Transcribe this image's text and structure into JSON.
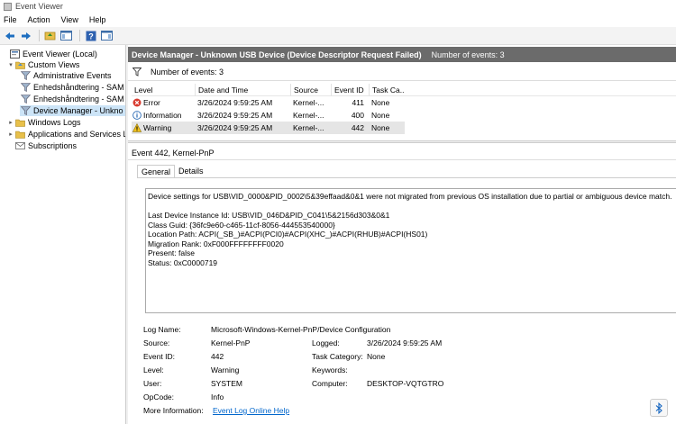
{
  "window": {
    "title": "Event Viewer"
  },
  "menu": [
    "File",
    "Action",
    "View",
    "Help"
  ],
  "toolbar": {
    "icons": [
      "back-arrow-icon",
      "forward-arrow-icon",
      "folder-up-icon",
      "console-tree-icon",
      "help-icon",
      "action-pane-icon"
    ]
  },
  "tree": {
    "root": "Event Viewer (Local)",
    "custom_views": "Custom Views",
    "admin_events": "Administrative Events",
    "enh1": "Enhedshåndtering - SAM",
    "enh2": "Enhedshåndtering - SAM",
    "device_manager": "Device Manager - Unkno",
    "windows_logs": "Windows Logs",
    "app_services": "Applications and Services Lo",
    "subscriptions": "Subscriptions"
  },
  "header": {
    "title": "Device Manager - Unknown USB Device (Device Descriptor Request Failed)",
    "count": "Number of events: 3"
  },
  "filter": {
    "label": "Number of events: 3"
  },
  "grid": {
    "columns": [
      "Level",
      "Date and Time",
      "Source",
      "Event ID",
      "Task Ca..."
    ],
    "rows": [
      {
        "level": "Error",
        "icon": "error-icon",
        "datetime": "3/26/2024 9:59:25 AM",
        "source": "Kernel-...",
        "event_id": "411",
        "task": "None"
      },
      {
        "level": "Information",
        "icon": "info-icon",
        "datetime": "3/26/2024 9:59:25 AM",
        "source": "Kernel-...",
        "event_id": "400",
        "task": "None"
      },
      {
        "level": "Warning",
        "icon": "warning-icon",
        "datetime": "3/26/2024 9:59:25 AM",
        "source": "Kernel-...",
        "event_id": "442",
        "task": "None"
      }
    ]
  },
  "details": {
    "title": "Event 442, Kernel-PnP",
    "tabs": [
      "General",
      "Details"
    ],
    "description": [
      "Device settings for USB\\VID_0000&PID_0002\\5&39effaad&0&1 were not migrated from previous OS installation due to partial or ambiguous device match.",
      "",
      "Last Device Instance Id: USB\\VID_046D&PID_C041\\5&2156d303&0&1",
      "Class Guid: {36fc9e60-c465-11cf-8056-444553540000}",
      "Location Path: ACPI(_SB_)#ACPI(PCI0)#ACPI(XHC_)#ACPI(RHUB)#ACPI(HS01)",
      "Migration Rank: 0xF000FFFFFFFF0020",
      "Present: false",
      "Status: 0xC0000719"
    ],
    "props": {
      "log_name_label": "Log Name:",
      "log_name": "Microsoft-Windows-Kernel-PnP/Device Configuration",
      "source_label": "Source:",
      "source": "Kernel-PnP",
      "logged_label": "Logged:",
      "logged": "3/26/2024 9:59:25 AM",
      "event_id_label": "Event ID:",
      "event_id": "442",
      "task_label": "Task Category:",
      "task": "None",
      "level_label": "Level:",
      "level": "Warning",
      "keywords_label": "Keywords:",
      "keywords": "",
      "user_label": "User:",
      "user": "SYSTEM",
      "computer_label": "Computer:",
      "computer": "DESKTOP-VQTGTRO",
      "opcode_label": "OpCode:",
      "opcode": "Info",
      "more_info_label": "More Information:",
      "more_info_link": "Event Log Online Help"
    }
  },
  "colors": {
    "header_bg": "#6b6b6b",
    "selection": "#cce4f7",
    "link": "#0066cc"
  }
}
